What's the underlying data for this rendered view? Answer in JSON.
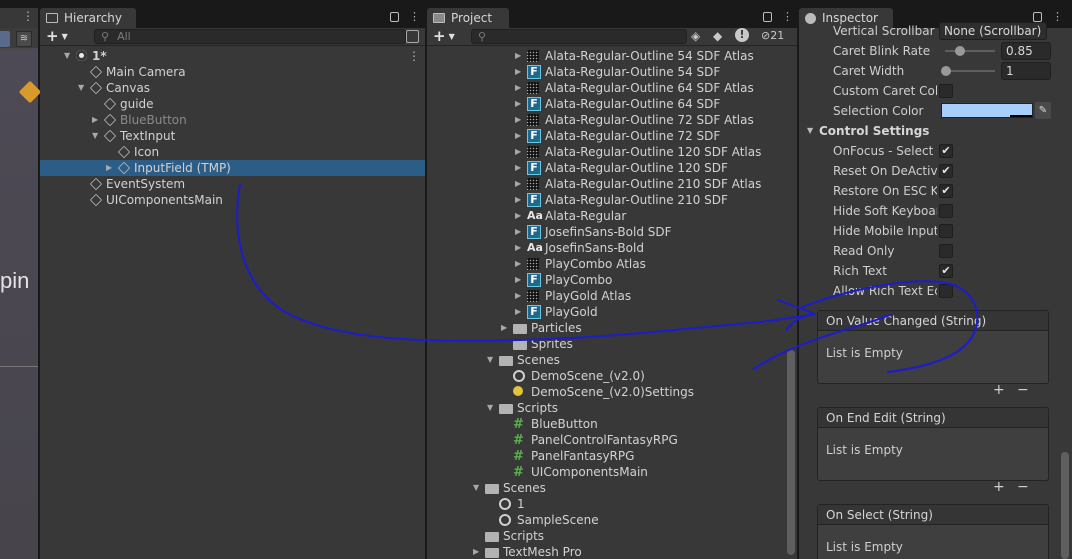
{
  "scene_view": {
    "overlay_text": "pin"
  },
  "hierarchy": {
    "tab": "Hierarchy",
    "search_placeholder": "All",
    "items": [
      {
        "label": "1*",
        "icon": "unity-icon",
        "depth": 0,
        "arrow": "▼"
      },
      {
        "label": "Main Camera",
        "icon": "cube-icon",
        "depth": 1,
        "arrow": ""
      },
      {
        "label": "Canvas",
        "icon": "cube-icon",
        "depth": 1,
        "arrow": "▼"
      },
      {
        "label": "guide",
        "icon": "cube-icon",
        "depth": 2,
        "arrow": ""
      },
      {
        "label": "BlueButton",
        "icon": "cube-icon",
        "depth": 2,
        "arrow": "▶",
        "dim": true
      },
      {
        "label": "TextInput",
        "icon": "cube-icon",
        "depth": 2,
        "arrow": "▼"
      },
      {
        "label": "Icon",
        "icon": "cube-icon",
        "depth": 3,
        "arrow": ""
      },
      {
        "label": "InputField (TMP)",
        "icon": "cube-icon",
        "depth": 3,
        "arrow": "▶",
        "selected": true
      },
      {
        "label": "EventSystem",
        "icon": "cube-icon",
        "depth": 1,
        "arrow": ""
      },
      {
        "label": "UIComponentsMain",
        "icon": "cube-icon",
        "depth": 1,
        "arrow": ""
      }
    ]
  },
  "project": {
    "tab": "Project",
    "hidden_count": "21",
    "items": [
      {
        "label": "Alata-Regular-Outline 54 SDF Atlas",
        "icon": "atlas",
        "indent": 2,
        "arrow": "▶"
      },
      {
        "label": "Alata-Regular-Outline 54 SDF",
        "icon": "font",
        "indent": 2,
        "arrow": "▶"
      },
      {
        "label": "Alata-Regular-Outline 64 SDF Atlas",
        "icon": "atlas",
        "indent": 2,
        "arrow": "▶"
      },
      {
        "label": "Alata-Regular-Outline 64 SDF",
        "icon": "font",
        "indent": 2,
        "arrow": "▶"
      },
      {
        "label": "Alata-Regular-Outline 72 SDF Atlas",
        "icon": "atlas",
        "indent": 2,
        "arrow": "▶"
      },
      {
        "label": "Alata-Regular-Outline 72 SDF",
        "icon": "font",
        "indent": 2,
        "arrow": "▶"
      },
      {
        "label": "Alata-Regular-Outline 120 SDF Atlas",
        "icon": "atlas",
        "indent": 2,
        "arrow": "▶"
      },
      {
        "label": "Alata-Regular-Outline 120 SDF",
        "icon": "font",
        "indent": 2,
        "arrow": "▶"
      },
      {
        "label": "Alata-Regular-Outline 210 SDF Atlas",
        "icon": "atlas",
        "indent": 2,
        "arrow": "▶"
      },
      {
        "label": "Alata-Regular-Outline 210 SDF",
        "icon": "font",
        "indent": 2,
        "arrow": "▶"
      },
      {
        "label": "Alata-Regular",
        "icon": "aa",
        "indent": 2,
        "arrow": "▶"
      },
      {
        "label": "JosefinSans-Bold SDF",
        "icon": "font",
        "indent": 2,
        "arrow": "▶"
      },
      {
        "label": "JosefinSans-Bold",
        "icon": "aa",
        "indent": 2,
        "arrow": "▶"
      },
      {
        "label": "PlayCombo Atlas",
        "icon": "atlas",
        "indent": 2,
        "arrow": "▶"
      },
      {
        "label": "PlayCombo",
        "icon": "font",
        "indent": 2,
        "arrow": "▶"
      },
      {
        "label": "PlayGold Atlas",
        "icon": "atlas",
        "indent": 2,
        "arrow": "▶"
      },
      {
        "label": "PlayGold",
        "icon": "font",
        "indent": 2,
        "arrow": "▶"
      },
      {
        "label": "Particles",
        "icon": "folder",
        "indent": 1,
        "arrow": "▶"
      },
      {
        "label": "Sprites",
        "icon": "folder",
        "indent": 1,
        "arrow": ""
      },
      {
        "label": "Scenes",
        "icon": "folder",
        "indent": 0,
        "arrow": "▼"
      },
      {
        "label": "DemoScene_(v2.0)",
        "icon": "scene",
        "indent": 1,
        "arrow": ""
      },
      {
        "label": "DemoScene_(v2.0)Settings",
        "icon": "bulb",
        "indent": 1,
        "arrow": ""
      },
      {
        "label": "Scripts",
        "icon": "folder",
        "indent": 0,
        "arrow": "▼"
      },
      {
        "label": "BlueButton",
        "icon": "script",
        "indent": 1,
        "arrow": ""
      },
      {
        "label": "PanelControlFantasyRPG",
        "icon": "script",
        "indent": 1,
        "arrow": ""
      },
      {
        "label": "PanelFantasyRPG",
        "icon": "script",
        "indent": 1,
        "arrow": ""
      },
      {
        "label": "UIComponentsMain",
        "icon": "script",
        "indent": 1,
        "arrow": ""
      },
      {
        "label": "Scenes",
        "icon": "folder",
        "indent": -1,
        "arrow": "▼"
      },
      {
        "label": "1",
        "icon": "scene",
        "indent": 0,
        "arrow": ""
      },
      {
        "label": "SampleScene",
        "icon": "scene",
        "indent": 0,
        "arrow": ""
      },
      {
        "label": "Scripts",
        "icon": "folder",
        "indent": -1,
        "arrow": ""
      },
      {
        "label": "TextMesh Pro",
        "icon": "folder",
        "indent": -1,
        "arrow": "▶"
      }
    ]
  },
  "inspector": {
    "tab": "Inspector",
    "vertical_scrollbar_label": "Vertical Scrollbar",
    "vertical_scrollbar_value": "None (Scrollbar)",
    "caret_blink_label": "Caret Blink Rate",
    "caret_blink_value": "0.85",
    "caret_blink_fraction": 0.28,
    "caret_width_label": "Caret Width",
    "caret_width_value": "1",
    "caret_width_fraction": 0.0,
    "custom_caret_label": "Custom Caret Colo",
    "selection_color_label": "Selection Color",
    "selection_color": "#a8cefb",
    "control_settings_label": "Control Settings",
    "toggles": [
      {
        "label": "OnFocus - Select A",
        "checked": true
      },
      {
        "label": "Reset On DeActiva",
        "checked": true
      },
      {
        "label": "Restore On ESC Ke",
        "checked": true
      },
      {
        "label": "Hide Soft Keyboard",
        "checked": false
      },
      {
        "label": "Hide Mobile Input",
        "checked": false
      },
      {
        "label": "Read Only",
        "checked": false
      },
      {
        "label": "Rich Text",
        "checked": true
      },
      {
        "label": "Allow Rich Text Ed",
        "checked": false
      }
    ],
    "events": [
      {
        "title": "On Value Changed (String)",
        "body": "List is Empty"
      },
      {
        "title": "On End Edit (String)",
        "body": "List is Empty"
      },
      {
        "title": "On Select (String)",
        "body": "List is Empty"
      }
    ]
  },
  "annotation_color": "#1c1ccf"
}
